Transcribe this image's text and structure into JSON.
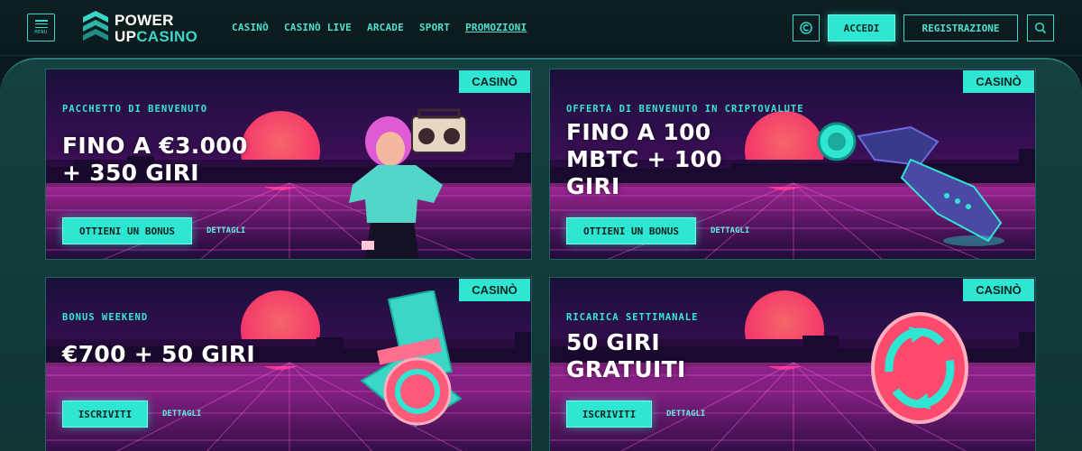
{
  "header": {
    "menu_label": "MENU",
    "logo_line1": "POWER",
    "logo_up": "UP",
    "logo_casino": "CASINO",
    "nav": [
      "CASINÒ",
      "CASINÒ LIVE",
      "ARCADE",
      "SPORT",
      "PROMOZIONI"
    ],
    "active_nav": "PROMOZIONI",
    "login_label": "ACCEDI",
    "register_label": "REGISTRAZIONE"
  },
  "promos": [
    {
      "tag": "CASINÒ",
      "subtitle": "PACCHETTO DI BENVENUTO",
      "headline_line1": "FINO A €3.000",
      "headline_line2": "+ 350 GIRI",
      "headline_line3": "",
      "cta": "OTTIENI UN BONUS",
      "details": "DETTAGLI",
      "art": "retro-girl-with-boombox"
    },
    {
      "tag": "CASINÒ",
      "subtitle": "OFFERTA DI BENVENUTO IN CRIPTOVALUTE",
      "headline_line1": "FINO A 100",
      "headline_line2": "MBTC + 100",
      "headline_line3": "GIRI",
      "cta": "OTTIENI UN BONUS",
      "details": "DETTAGLI",
      "art": "robotic-glove-with-chip"
    },
    {
      "tag": "CASINÒ",
      "subtitle": "BONUS WEEKEND",
      "headline_line1": "€700 + 50 GIRI",
      "headline_line2": "",
      "headline_line3": "",
      "cta": "ISCRIVITI",
      "details": "DETTAGLI",
      "art": "cash-stack-with-coin"
    },
    {
      "tag": "CASINÒ",
      "subtitle": "RICARICA SETTIMANALE",
      "headline_line1": "50 GIRI",
      "headline_line2": "GRATUITI",
      "headline_line3": "",
      "cta": "ISCRIVITI",
      "details": "DETTAGLI",
      "art": "pink-refresh-coin"
    }
  ],
  "colors": {
    "accent": "#2ee6d2",
    "background": "#0a1a1c",
    "panel": "#14403f",
    "sunset": "#ff4a6a",
    "magenta": "#c21ea0"
  }
}
